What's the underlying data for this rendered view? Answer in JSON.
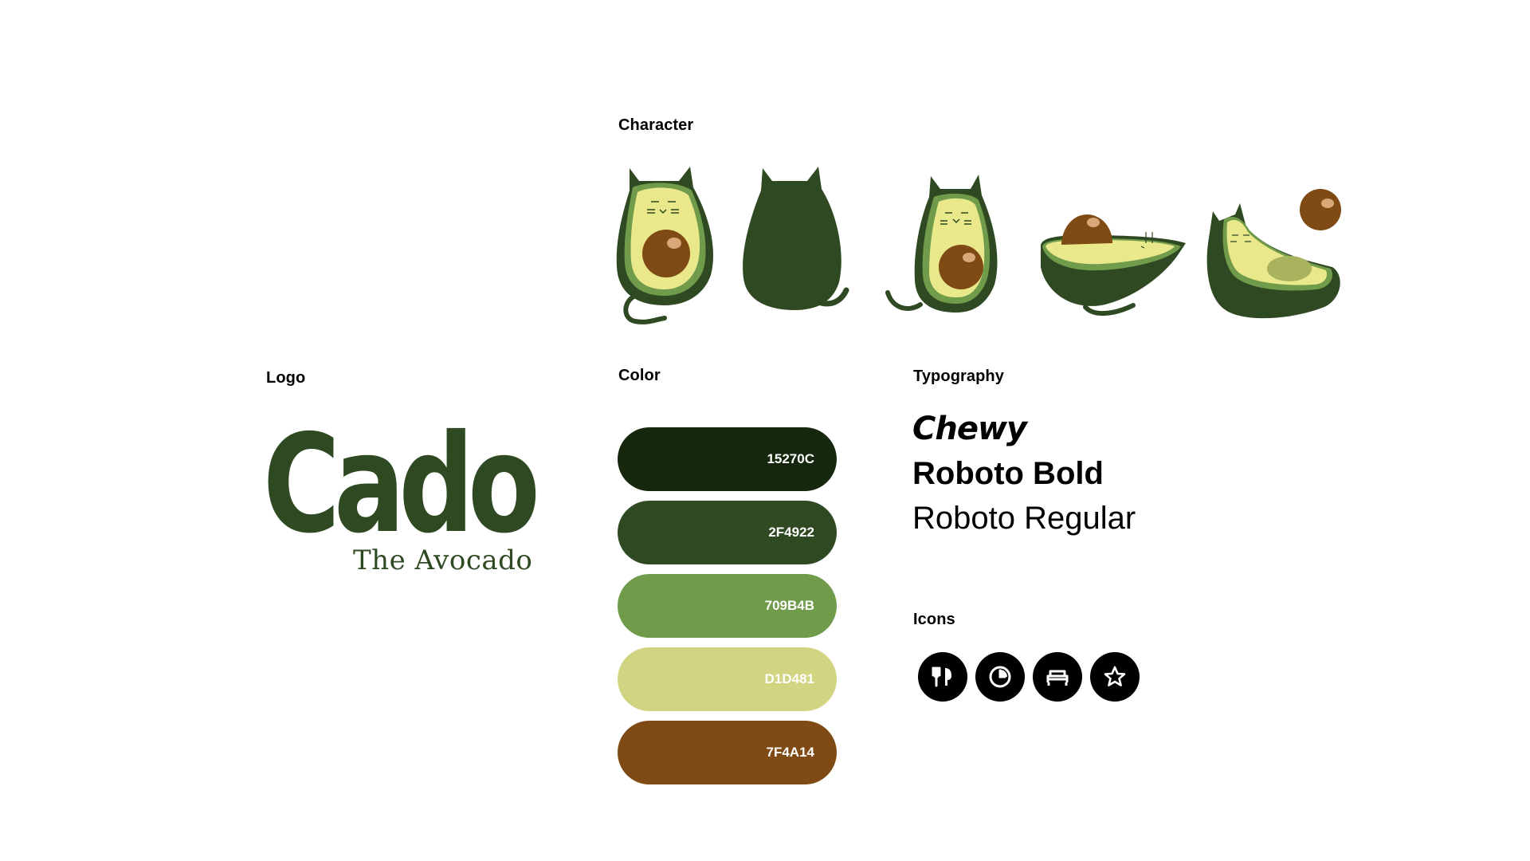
{
  "sections": {
    "character": "Character",
    "logo": "Logo",
    "color": "Color",
    "typography": "Typography",
    "icons": "Icons"
  },
  "logo": {
    "wordmark": "Cado",
    "tagline": "The Avocado"
  },
  "palette": [
    {
      "hex": "15270C",
      "color": "#15270C"
    },
    {
      "hex": "2F4922",
      "color": "#2F4922"
    },
    {
      "hex": "709B4B",
      "color": "#709B4B"
    },
    {
      "hex": "D1D481",
      "color": "#D1D481"
    },
    {
      "hex": "7F4A14",
      "color": "#7F4A14"
    }
  ],
  "typography": {
    "samples": [
      "Chewy",
      "Roboto Bold",
      "Roboto Regular"
    ]
  },
  "icons": [
    {
      "name": "fork-knife-icon"
    },
    {
      "name": "clock-icon"
    },
    {
      "name": "bed-icon"
    },
    {
      "name": "star-icon"
    }
  ],
  "characters": [
    {
      "name": "avocado-cat-front"
    },
    {
      "name": "avocado-cat-back"
    },
    {
      "name": "avocado-cat-tail-left"
    },
    {
      "name": "avocado-cat-lying"
    },
    {
      "name": "avocado-cat-pit-ball"
    }
  ]
}
